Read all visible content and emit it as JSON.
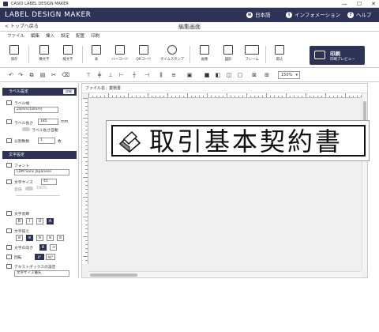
{
  "window": {
    "title": "CASIO LABEL DESIGN MAKER",
    "min": "—",
    "max": "☐",
    "close": "✕"
  },
  "header": {
    "brand": "LABEL DESIGN MAKER",
    "language": "日本語",
    "info": "インフォメーション",
    "help": "ヘルプ"
  },
  "nav": {
    "back": "< トップへ戻る",
    "page_title": "編集画面"
  },
  "menu": [
    "ファイル",
    "編集",
    "挿入",
    "設定",
    "配置",
    "印刷"
  ],
  "ribbon": {
    "save": "保存",
    "horizontal_text": "横文字",
    "vertical_text": "縦文字",
    "table": "表",
    "barcode": "バーコード",
    "qrcode": "QRコード",
    "timestamp": "タイムスタンプ",
    "image": "画像",
    "clipart": "図形",
    "frame": "フレーム",
    "import": "取込",
    "print_label": "印刷",
    "print_preview": "印刷プレビュー"
  },
  "toolbar": {
    "zoom": "150%"
  },
  "label_settings": {
    "header": "ラベル設定",
    "detail_button": "詳細",
    "tape_label": "ラベル幅",
    "tape_value": "24mm(18mm)",
    "length_label": "ラベル長さ",
    "length_value": "185",
    "length_unit": "mm",
    "auto_label": "ラベル長さ自動",
    "split_label": "分割数数",
    "split_value": "1",
    "split_unit": "枚"
  },
  "text_settings": {
    "header": "文字設定",
    "font_label": "フォント",
    "font_value": "LDM Sans Japanese",
    "size_label": "文字サイズ",
    "size_value": "45",
    "change_label": "変倍",
    "change_value": "100%",
    "decoration_label": "文字装飾",
    "bold": "B",
    "italic": "I",
    "underline": "U",
    "outline": "A",
    "align_label": "文字揃え",
    "direction_label": "文字の向き",
    "rotation_label": "回転",
    "rotation_0": "0°",
    "rotation_90": "90°",
    "textbox_label": "テキストボックスの設定",
    "textbox_value": "文字サイズ優先"
  },
  "canvas": {
    "file_label": "ファイル名：",
    "file_name": "業務書",
    "label_text": "取引基本契約書"
  }
}
